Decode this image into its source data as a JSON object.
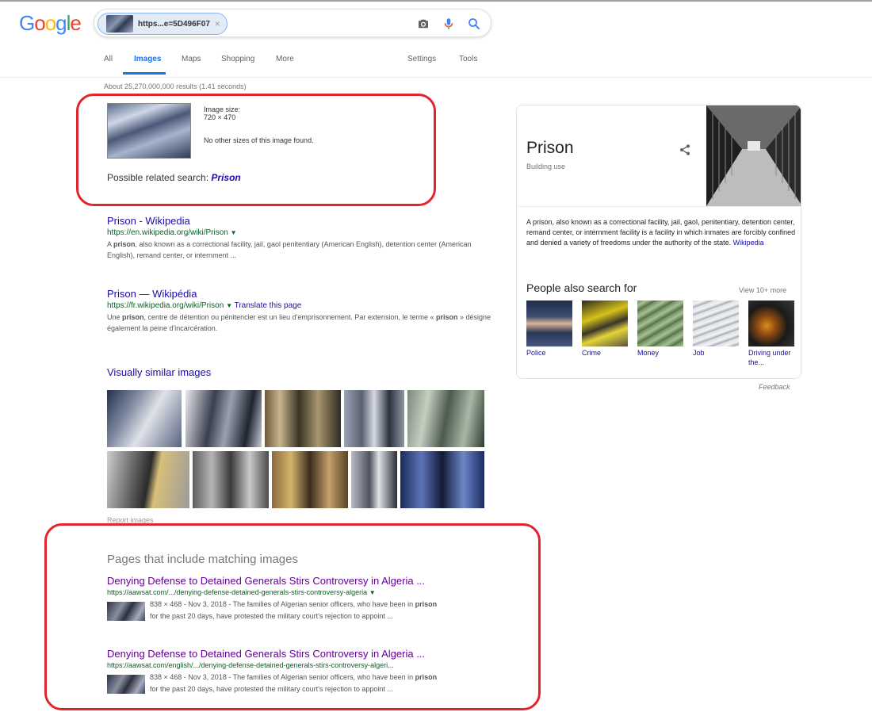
{
  "header": {
    "logo_letters": [
      {
        "ch": "G",
        "color": "#4285F4"
      },
      {
        "ch": "o",
        "color": "#EA4335"
      },
      {
        "ch": "o",
        "color": "#FBBC05"
      },
      {
        "ch": "g",
        "color": "#4285F4"
      },
      {
        "ch": "l",
        "color": "#34A853"
      },
      {
        "ch": "e",
        "color": "#EA4335"
      }
    ],
    "chip_text": "https...e=5D496F07",
    "chip_close": "×"
  },
  "tabs": {
    "all": "All",
    "images": "Images",
    "maps": "Maps",
    "shopping": "Shopping",
    "more": "More",
    "settings": "Settings",
    "tools": "Tools"
  },
  "stats": "About 25,270,000,000 results (1.41 seconds)",
  "image_info": {
    "size_label": "Image size:",
    "size_value": "720 × 470",
    "no_other_sizes": "No other sizes of this image found.",
    "related_prefix": "Possible related search: ",
    "related_term": "Prison"
  },
  "results": [
    {
      "title": "Prison - Wikipedia",
      "url": "https://en.wikipedia.org/wiki/Prison",
      "caret": "▼",
      "translate": "",
      "snippet_bold": "prison",
      "snippet_pre": "A ",
      "snippet_post": ", also known as a correctional facility, jail, gaol penitentiary (American English), detention center (American English), remand center, or internment ..."
    },
    {
      "title": "Prison — Wikipédia",
      "url": "https://fr.wikipedia.org/wiki/Prison",
      "caret": "▼",
      "translate": "Translate this page",
      "snippet_pre": "Une ",
      "snippet_bold": "prison",
      "snippet_mid": ", centre de détention ou pénitencier est un lieu d'emprisonnement. Par extension, le terme «",
      "snippet_bold2": "prison",
      "snippet_post": " » désigne également la peine d'incarcération."
    }
  ],
  "visually_similar": {
    "title": "Visually similar images",
    "report": "Report images"
  },
  "matching": {
    "heading": "Pages that include matching images",
    "items": [
      {
        "title": "Denying Defense to Detained Generals Stirs Controversy in Algeria ...",
        "url": "https://aawsat.com/.../denying-defense-detained-generals-stirs-controversy-algeria",
        "caret": "▼",
        "line1_pre": "838 × 468 - Nov 3, 2018 - The families of Algerian senior officers, who have been in ",
        "line1_bold": "prison",
        "line2": "for the past 20 days, have protested the military court's rejection to appoint ..."
      },
      {
        "title": "Denying Defense to Detained Generals Stirs Controversy in Algeria ...",
        "url": "https://aawsat.com/english/.../denying-defense-detained-generals-stirs-controversy-algeri...",
        "caret": "",
        "line1_pre": "838 × 468 - Nov 3, 2018 - The families of Algerian senior officers, who have been in ",
        "line1_bold": "prison",
        "line2": "for the past 20 days, have protested the military court's rejection to appoint ..."
      }
    ]
  },
  "knowledge_panel": {
    "title": "Prison",
    "subtitle": "Building use",
    "description": "A prison, also known as a correctional facility, jail, gaol, penitentiary, detention center, remand center, or internment facility is a facility in which inmates are forcibly confined and denied a variety of freedoms under the authority of the state. ",
    "source": "Wikipedia",
    "people_also_search": "People also search for",
    "view_more": "View 10+ more",
    "tiles": [
      {
        "label": "Police"
      },
      {
        "label": "Crime"
      },
      {
        "label": "Money"
      },
      {
        "label": "Job"
      },
      {
        "label": "Driving under the..."
      }
    ],
    "feedback": "Feedback"
  },
  "colors": {
    "accent": "#1a73e8",
    "link": "#1a0dab",
    "visited": "#660099",
    "url_green": "#006621",
    "highlight_box": "#e2252b"
  }
}
